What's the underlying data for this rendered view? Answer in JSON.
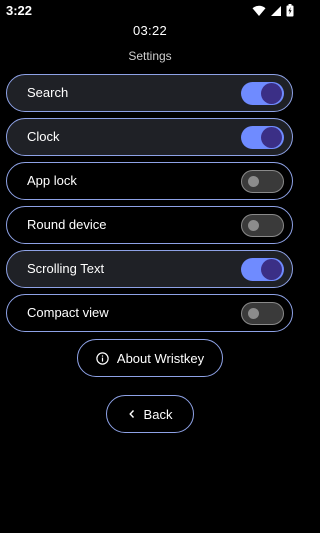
{
  "status_bar": {
    "time": "3:22",
    "icons": [
      "wifi-icon",
      "cellular-signal-icon",
      "battery-charging-icon"
    ]
  },
  "clock": "03:22",
  "title": "Settings",
  "settings": [
    {
      "label": "Search",
      "enabled": true
    },
    {
      "label": "Clock",
      "enabled": true
    },
    {
      "label": "App lock",
      "enabled": false
    },
    {
      "label": "Round device",
      "enabled": false
    },
    {
      "label": "Scrolling Text",
      "enabled": true
    },
    {
      "label": "Compact view",
      "enabled": false
    }
  ],
  "about_button": {
    "label": "About Wristkey",
    "icon": "info-icon"
  },
  "back_button": {
    "label": "Back",
    "icon": "chevron-left-icon"
  },
  "colors": {
    "background": "#000000",
    "outline": "#8ea2e6",
    "toggle_on_track": "#6f8bff",
    "toggle_on_knob": "#3b2f86",
    "toggle_off_track": "#3a3a3a",
    "toggle_off_knob": "#8c8c8c"
  }
}
